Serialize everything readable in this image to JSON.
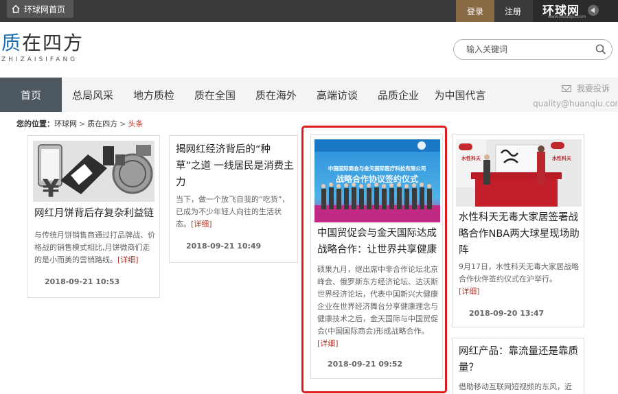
{
  "topbar": {
    "home_label": "环球网首页",
    "login_label": "登录",
    "register_label": "注册",
    "logo_text": "环球网",
    "logo_sub": "www.huanqiu.com"
  },
  "brand": {
    "title_accent": "质",
    "title_rest": "在四方",
    "subtitle": "ZHIZAISIFANG"
  },
  "search": {
    "placeholder": "输入关键词"
  },
  "nav": {
    "items": [
      {
        "label": "首页"
      },
      {
        "label": "总局风采"
      },
      {
        "label": "地方质检"
      },
      {
        "label": "质在全国"
      },
      {
        "label": "质在海外"
      },
      {
        "label": "高端访谈"
      },
      {
        "label": "品质企业"
      },
      {
        "label": "为中国代言"
      }
    ],
    "complaint_label": "我要投诉",
    "email": "quality@huanqiu.com"
  },
  "breadcrumb": {
    "label": "您的位置：",
    "items": [
      "环球网",
      "质在四方",
      "头条"
    ],
    "sep": ">"
  },
  "more_label": "[详细]",
  "cards": [
    {
      "title": "网红月饼背后存复杂利益链",
      "desc": "与传统月饼销售商通过打品牌战、价格战的销售模式相比,月饼微商们走的是小而美的营销路线。",
      "date": "2018-09-21 10:53"
    },
    {
      "title": "揭网红经济背后的“种草”之道 一线居民是消费主力",
      "desc": "当下，做一个放飞自我的“吃货”，已成为不少年轻人向往的生活状态。",
      "date": "2018-09-21 10:49"
    },
    {
      "title": "中国贸促会与金天国际达成战略合作：让世界共享健康",
      "desc": "硕果九月，继出席中非合作论坛北京峰会、俄罗斯东方经济论坛、达沃斯世界经济论坛，代表中国新兴大健康企业在世界经济舞台分享健康理念与健康技术之后，金天国际与中国贸促会(中国国际商会)形成战略合作。",
      "date": "2018-09-21 09:52",
      "banner_text": "中国国际商会与金天国际医疗科技有限公司",
      "banner_text2": "战略合作协议签约仪式"
    },
    {
      "title": "水性科天无毒大家居签署战略合作NBA两大球星现场助阵",
      "desc": "9月17日，水性科天无毒大家居战略合作伙伴签约仪式在沪举行。",
      "date": "2018-09-20 13:47",
      "banner_text": "水性科天"
    },
    {
      "title": "网红产品：靠流量还是靠质量？",
      "desc": "借助移动互联网短视频的东风，近"
    }
  ],
  "colors": {
    "topbar": "#3a3a3a",
    "login": "#8a6a44",
    "nav_active": "#4d5860",
    "highlight": "#e21c1c",
    "more": "#b03a2e"
  }
}
